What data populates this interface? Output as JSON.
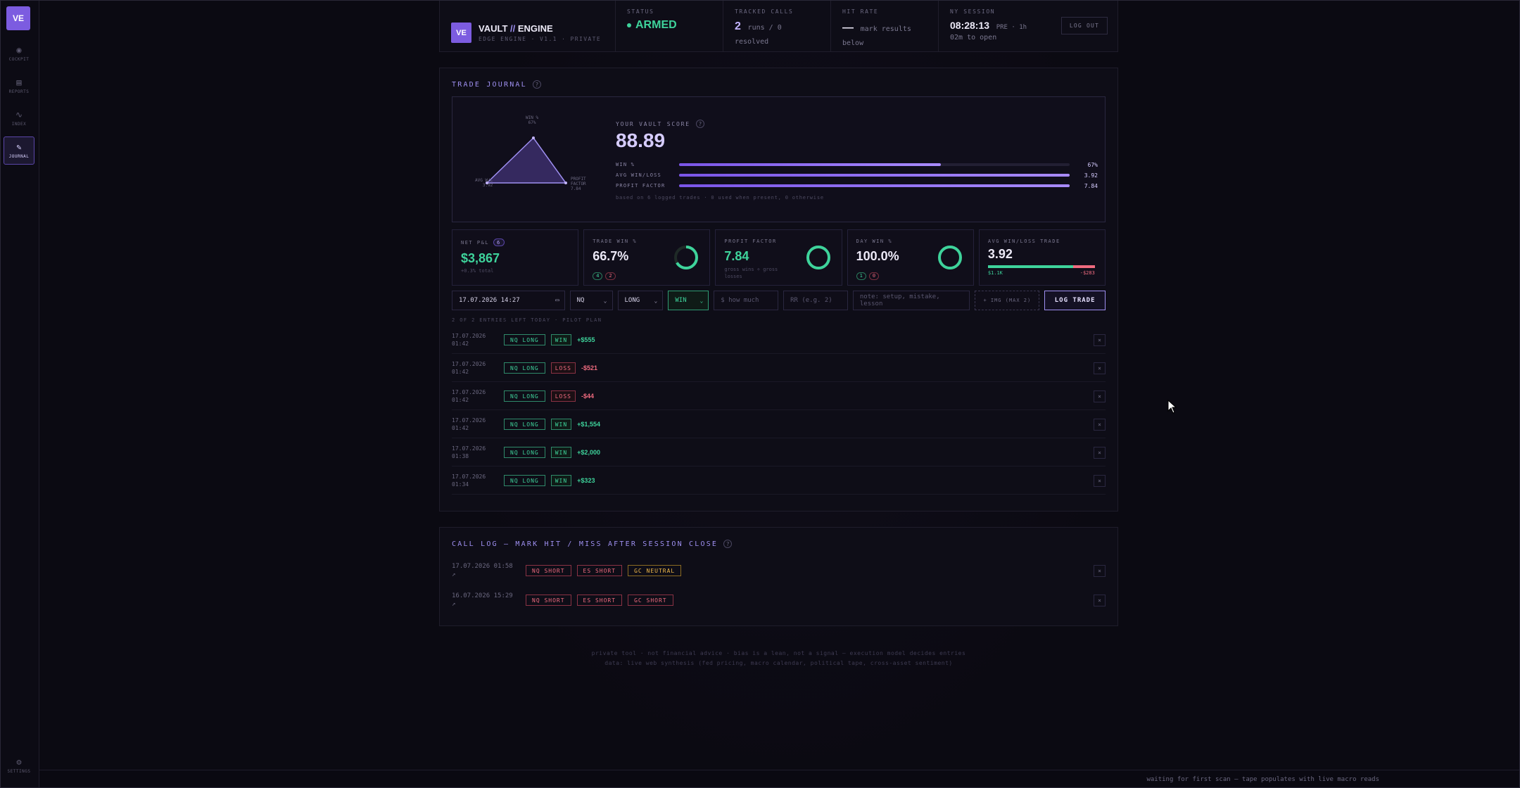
{
  "sidebar": {
    "logo": "VE",
    "items": [
      {
        "icon": "cockpit-icon",
        "glyph": "◉",
        "label": "COCKPIT"
      },
      {
        "icon": "reports-icon",
        "glyph": "▤",
        "label": "REPORTS"
      },
      {
        "icon": "index-icon",
        "glyph": "∿",
        "label": "INDEX"
      },
      {
        "icon": "journal-icon",
        "glyph": "✎",
        "label": "JOURNAL"
      }
    ],
    "settings": {
      "glyph": "⚙",
      "label": "SETTINGS"
    }
  },
  "header": {
    "badge": "VE",
    "name_a": "VAULT ",
    "name_sep": "//",
    "name_b": " ENGINE",
    "sub": "EDGE ENGINE · V1.1 · PRIVATE",
    "status_label": "STATUS",
    "status_value": "ARMED",
    "tracked_label": "TRACKED CALLS",
    "tracked_count": "2",
    "tracked_text": "runs / 0 resolved",
    "hit_label": "HIT RATE",
    "hit_value": "—",
    "hit_text": "mark results below",
    "session_label": "NY SESSION",
    "session_time": "08:28:13",
    "session_pre": "PRE · 1h",
    "session_open": "02m to open",
    "logout": "LOG OUT"
  },
  "journal": {
    "title": "TRADE JOURNAL",
    "help": "?",
    "radar": {
      "win_label": "WIN %",
      "win_value": "67%",
      "avg_label": "AVG W/L",
      "avg_value": "3.92",
      "pf_label": "PROFIT FACTOR",
      "pf_value": "7.84"
    },
    "score_label": "YOUR VAULT SCORE",
    "score_value": "88.89",
    "bars": [
      {
        "label": "WIN %",
        "value": "67%",
        "fraction": 0.67
      },
      {
        "label": "AVG WIN/LOSS",
        "value": "3.92",
        "fraction": 1.0
      },
      {
        "label": "PROFIT FACTOR",
        "value": "7.84",
        "fraction": 1.0
      }
    ],
    "score_note": "based on 6 logged trades · 0 used when present, 0 otherwise"
  },
  "cards": {
    "net_pnl": {
      "label": "NET P&L",
      "badge": "6",
      "value": "$3,867",
      "sub": "+0.3% total"
    },
    "trade_win": {
      "label": "TRADE WIN %",
      "value": "66.7%",
      "wins": "4",
      "losses": "2",
      "fraction": 0.667
    },
    "profit_factor": {
      "label": "PROFIT FACTOR",
      "value": "7.84",
      "sub": "gross wins ÷ gross losses",
      "fraction": 1.0
    },
    "day_win": {
      "label": "DAY WIN %",
      "value": "100.0%",
      "wins": "1",
      "losses": "0",
      "fraction": 1.0
    },
    "avg_wl": {
      "label": "AVG WIN/LOSS TRADE",
      "value": "3.92",
      "win_amt": "$1.1K",
      "loss_amt": "-$283",
      "win_fraction": 0.8
    }
  },
  "form": {
    "datetime": "17.07.2026 14:27",
    "symbol": "NQ",
    "direction": "LONG",
    "result": "WIN",
    "amount_placeholder": "$ how much",
    "rr_placeholder": "RR (e.g. 2)",
    "note_placeholder": "note: setup, mistake, lesson",
    "img_button": "+ IMG (MAX 2)",
    "log_button": "LOG TRADE",
    "entries_note": "2 OF 2 ENTRIES LEFT TODAY · PILOT PLAN"
  },
  "trades": [
    {
      "date": "17.07.2026",
      "time": "01:42",
      "tag": "NQ LONG",
      "result": "WIN",
      "pnl": "+$555"
    },
    {
      "date": "17.07.2026",
      "time": "01:42",
      "tag": "NQ LONG",
      "result": "LOSS",
      "pnl": "-$521"
    },
    {
      "date": "17.07.2026",
      "time": "01:42",
      "tag": "NQ LONG",
      "result": "LOSS",
      "pnl": "-$44"
    },
    {
      "date": "17.07.2026",
      "time": "01:42",
      "tag": "NQ LONG",
      "result": "WIN",
      "pnl": "+$1,554"
    },
    {
      "date": "17.07.2026",
      "time": "01:38",
      "tag": "NQ LONG",
      "result": "WIN",
      "pnl": "+$2,000"
    },
    {
      "date": "17.07.2026",
      "time": "01:34",
      "tag": "NQ LONG",
      "result": "WIN",
      "pnl": "+$323"
    }
  ],
  "delete_glyph": "×",
  "calllog": {
    "title": "CALL LOG — MARK HIT / MISS AFTER SESSION CLOSE",
    "help": "?",
    "rows": [
      {
        "date": "17.07.2026 01:58",
        "mark": "↗",
        "tags": [
          {
            "t": "NQ SHORT",
            "k": "short"
          },
          {
            "t": "ES SHORT",
            "k": "short"
          },
          {
            "t": "GC NEUTRAL",
            "k": "neutral"
          }
        ]
      },
      {
        "date": "16.07.2026 15:29",
        "mark": "↗",
        "tags": [
          {
            "t": "NQ SHORT",
            "k": "short"
          },
          {
            "t": "ES SHORT",
            "k": "short"
          },
          {
            "t": "GC SHORT",
            "k": "short"
          }
        ]
      }
    ]
  },
  "footer": {
    "line1": "private tool · not financial advice · bias is a lean, not a signal — execution model decides entries",
    "line2": "data: live web synthesis (fed pricing, macro calendar, political tape, cross-asset sentiment)"
  },
  "statusbar": {
    "message": "waiting for first scan — tape populates with live macro reads"
  },
  "colors": {
    "accent": "#7c5ce0",
    "green": "#3ed39b",
    "red": "#ef6b7f",
    "amber": "#f0b94a"
  }
}
